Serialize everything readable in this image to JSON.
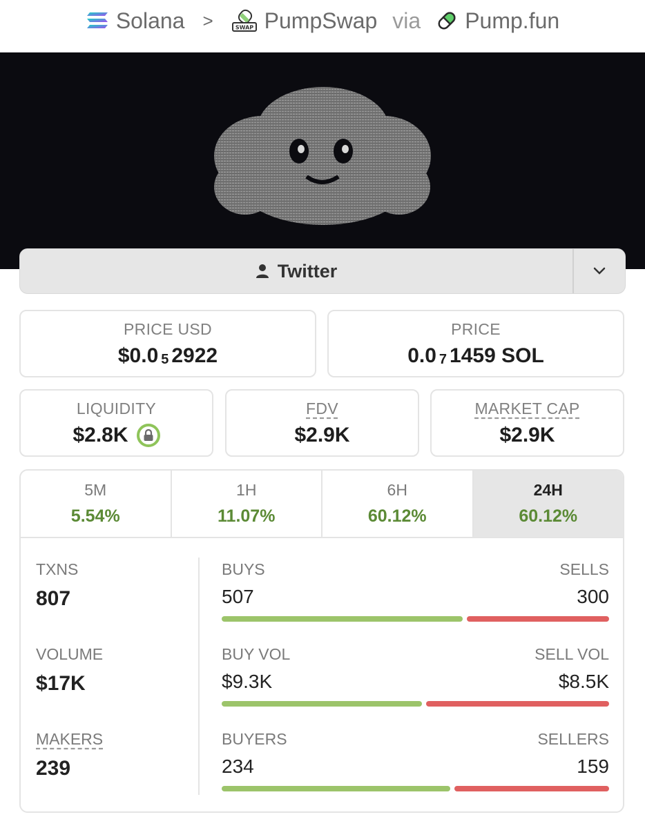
{
  "breadcrumb": {
    "chain": "Solana",
    "separator": ">",
    "dex": "PumpSwap",
    "via": "via",
    "launchpad": "Pump.fun",
    "icons": [
      "solana-icon",
      "pumpswap-icon",
      "pumpfun-pill-icon"
    ]
  },
  "social": {
    "label": "Twitter",
    "icon": "user-icon",
    "caret_icon": "chevron-down-icon"
  },
  "price_usd": {
    "label": "PRICE USD",
    "prefix": "$0.0",
    "zeros": "5",
    "digits": "2922"
  },
  "price_native": {
    "label": "PRICE",
    "prefix": "0.0",
    "zeros": "7",
    "digits": "1459 SOL"
  },
  "liquidity": {
    "label": "LIQUIDITY",
    "value": "$2.8K",
    "icon": "lock-icon"
  },
  "fdv": {
    "label": "FDV",
    "value": "$2.9K"
  },
  "market_cap": {
    "label": "MARKET CAP",
    "value": "$2.9K"
  },
  "timeframes": [
    {
      "label": "5M",
      "value": "5.54%"
    },
    {
      "label": "1H",
      "value": "11.07%"
    },
    {
      "label": "6H",
      "value": "60.12%"
    },
    {
      "label": "24H",
      "value": "60.12%"
    }
  ],
  "active_timeframe": "24H",
  "stats": {
    "txns": {
      "label": "TXNS",
      "value": "807"
    },
    "volume": {
      "label": "VOLUME",
      "value": "$17K"
    },
    "makers": {
      "label": "MAKERS",
      "value": "239"
    },
    "buys": {
      "label": "BUYS",
      "value": "507",
      "ratio": 0.628
    },
    "sells": {
      "label": "SELLS",
      "value": "300"
    },
    "buy_vol": {
      "label": "BUY VOL",
      "value": "$9.3K",
      "ratio": 0.522
    },
    "sell_vol": {
      "label": "SELL VOL",
      "value": "$8.5K"
    },
    "buyers": {
      "label": "BUYERS",
      "value": "234",
      "ratio": 0.595
    },
    "sellers": {
      "label": "SELLERS",
      "value": "159"
    }
  },
  "colors": {
    "positive": "#5b8a35",
    "buy_bar": "#9cc46a",
    "sell_bar": "#e06060"
  }
}
